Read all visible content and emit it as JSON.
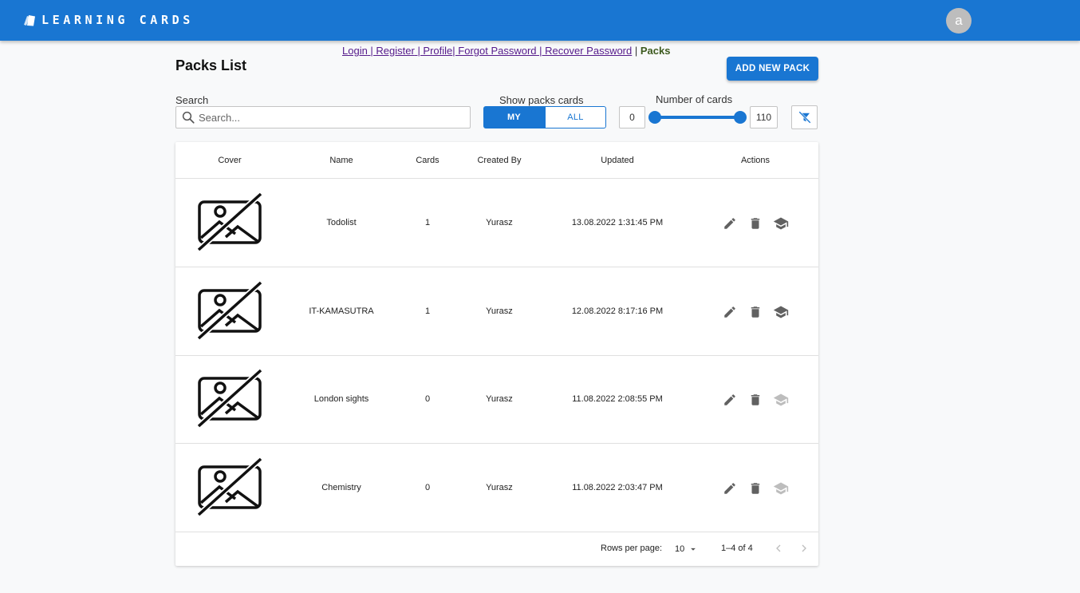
{
  "app": {
    "title": "LEARNING CARDS",
    "avatar_letter": "a"
  },
  "nav": {
    "login": "Login",
    "register": " | Register",
    "profile": " | Profile",
    "forgot": "| Forgot Password",
    "recover": " | Recover Password",
    "sep": " | ",
    "packs": "Packs"
  },
  "page": {
    "title": "Packs List",
    "add_button": "ADD NEW PACK"
  },
  "search": {
    "label": "Search",
    "placeholder": "Search..."
  },
  "show": {
    "label": "Show packs cards",
    "my": "MY",
    "all": "ALL"
  },
  "cards_range": {
    "label": "Number of cards",
    "min": "0",
    "max": "110"
  },
  "table": {
    "headers": [
      "Cover",
      "Name",
      "Cards",
      "Created By",
      "Updated",
      "Actions"
    ],
    "rows": [
      {
        "name": "Todolist",
        "cards": "1",
        "created_by": "Yurasz",
        "updated": "13.08.2022 1:31:45 PM",
        "learn_enabled": true
      },
      {
        "name": "IT-KAMASUTRA",
        "cards": "1",
        "created_by": "Yurasz",
        "updated": "12.08.2022 8:17:16 PM",
        "learn_enabled": true
      },
      {
        "name": "London sights",
        "cards": "0",
        "created_by": "Yurasz",
        "updated": "11.08.2022 2:08:55 PM",
        "learn_enabled": false
      },
      {
        "name": "Chemistry",
        "cards": "0",
        "created_by": "Yurasz",
        "updated": "11.08.2022 2:03:47 PM",
        "learn_enabled": false
      }
    ]
  },
  "pagination": {
    "rows_per_page_label": "Rows per page:",
    "rows_per_page": "10",
    "range": "1–4 of 4"
  },
  "colors": {
    "primary": "#1976d2",
    "icon": "#616161",
    "icon_disabled": "#bdbdbd"
  }
}
